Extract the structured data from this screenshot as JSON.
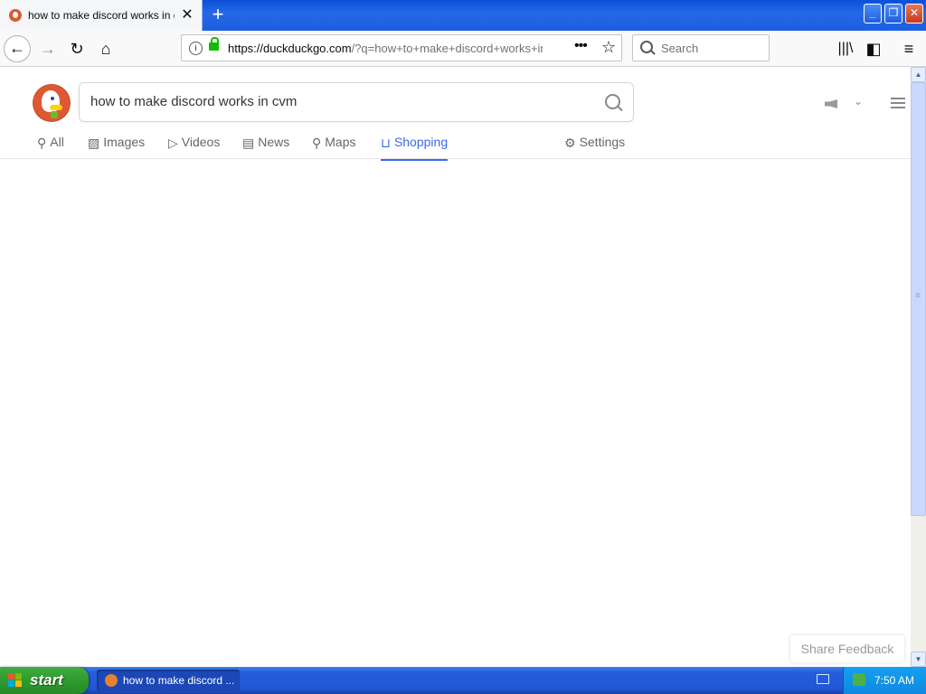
{
  "browser": {
    "tab": {
      "title": "how to make discord works in cvm",
      "close_glyph": "✕"
    },
    "new_tab_glyph": "+",
    "window_buttons": {
      "minimize": "_",
      "maximize": "❐",
      "close": "✕"
    },
    "toolbar": {
      "back_glyph": "←",
      "forward_glyph": "→",
      "reload_glyph": "↻",
      "home_glyph": "⌂",
      "info_glyph": "i",
      "url_host": "https://duckduckgo.com",
      "url_rest": "/?q=how+to+make+discord+works+in+cvm",
      "page_actions_glyph": "•••",
      "bookmark_glyph": "☆",
      "library_glyph": "|||\\",
      "sidebar_glyph": "◧",
      "menu_glyph": "≡"
    },
    "search": {
      "placeholder": "Search"
    }
  },
  "page": {
    "query": "how to make discord works in cvm",
    "tabs": [
      {
        "label": "All",
        "icon": "search-icon",
        "glyph": "⚲"
      },
      {
        "label": "Images",
        "icon": "image-icon",
        "glyph": "▨"
      },
      {
        "label": "Videos",
        "icon": "play-icon",
        "glyph": "▷"
      },
      {
        "label": "News",
        "icon": "newspaper-icon",
        "glyph": "▤"
      },
      {
        "label": "Maps",
        "icon": "map-pin-icon",
        "glyph": "⚲"
      },
      {
        "label": "Shopping",
        "icon": "shopping-bag-icon",
        "glyph": "⊔",
        "active": true
      },
      {
        "label": "Settings",
        "icon": "sliders-icon",
        "glyph": "⚙"
      }
    ],
    "share_feedback": "Share Feedback",
    "active_color": "#3969ef",
    "brand_color": "#de5833"
  },
  "taskbar": {
    "start_label": "start",
    "task_label": "how to make discord ...",
    "clock": "7:50 AM"
  }
}
